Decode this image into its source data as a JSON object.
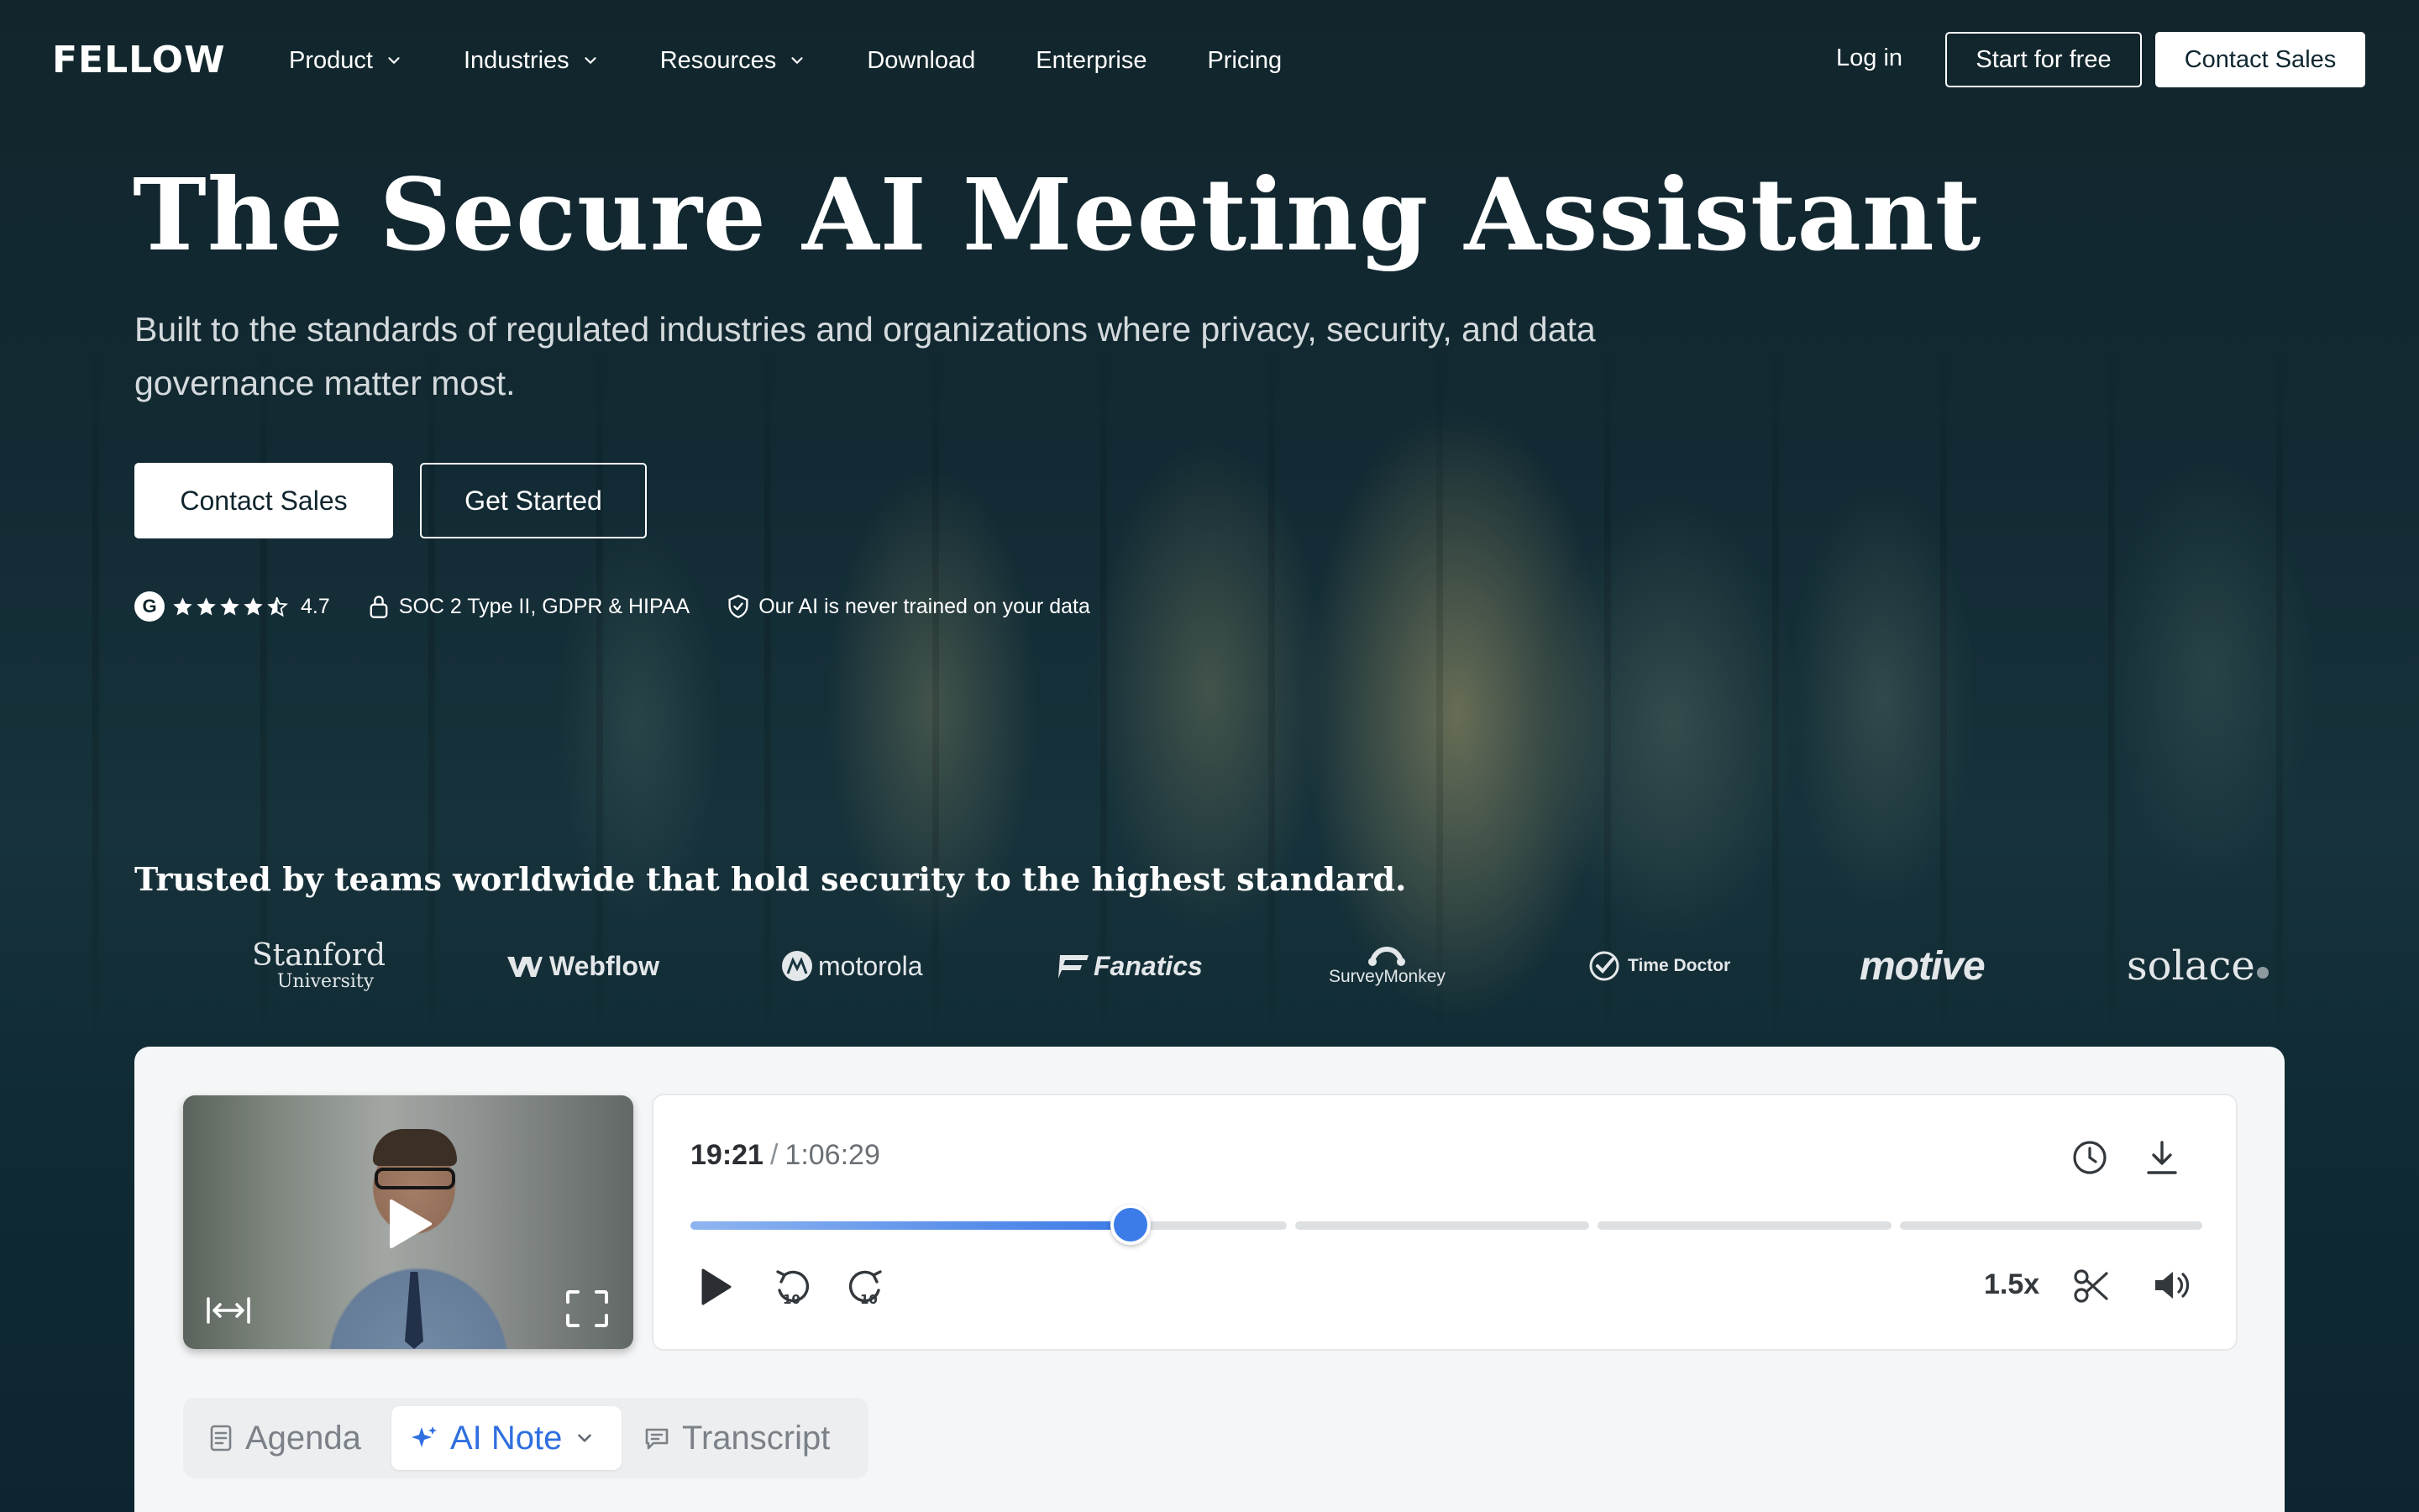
{
  "brand": {
    "logo_text": "FELLOW"
  },
  "nav": {
    "items": [
      {
        "label": "Product",
        "dropdown": true
      },
      {
        "label": "Industries",
        "dropdown": true
      },
      {
        "label": "Resources",
        "dropdown": true
      },
      {
        "label": "Download",
        "dropdown": false
      },
      {
        "label": "Enterprise",
        "dropdown": false
      },
      {
        "label": "Pricing",
        "dropdown": false
      }
    ],
    "login": "Log in",
    "start_free": "Start for free",
    "contact_sales": "Contact Sales"
  },
  "hero": {
    "title": "The Secure AI Meeting Assistant",
    "subtitle": "Built to the standards of regulated industries and organizations where privacy, security, and data governance matter most.",
    "cta_primary": "Contact Sales",
    "cta_secondary": "Get Started"
  },
  "badges": {
    "rating_logo": "G",
    "rating_stars": 4.5,
    "rating": "4.7",
    "compliance": "SOC 2 Type II, GDPR & HIPAA",
    "privacy": "Our AI is never trained on your data"
  },
  "trusted": {
    "heading": "Trusted by teams worldwide that hold security to the highest standard.",
    "logos": {
      "stanford_a": "Stanford",
      "stanford_b": "University",
      "webflow": "Webflow",
      "motorola": "motorola",
      "fanatics": "Fanatics",
      "surveymonkey": "SurveyMonkey",
      "timedoctor": "Time Doctor",
      "motive": "motive",
      "solace": "solace"
    }
  },
  "player": {
    "current_time": "19:21",
    "separator": "/",
    "total_time": "1:06:29",
    "speed": "1.5x",
    "progress_fraction": 0.291,
    "accent": "#3b7ce8"
  },
  "tabs": {
    "agenda": "Agenda",
    "ai_note": "AI Note",
    "transcript": "Transcript"
  },
  "colors": {
    "background": "#0f2630",
    "accent_blue": "#2f6fe0",
    "text_light": "#ffffff"
  }
}
